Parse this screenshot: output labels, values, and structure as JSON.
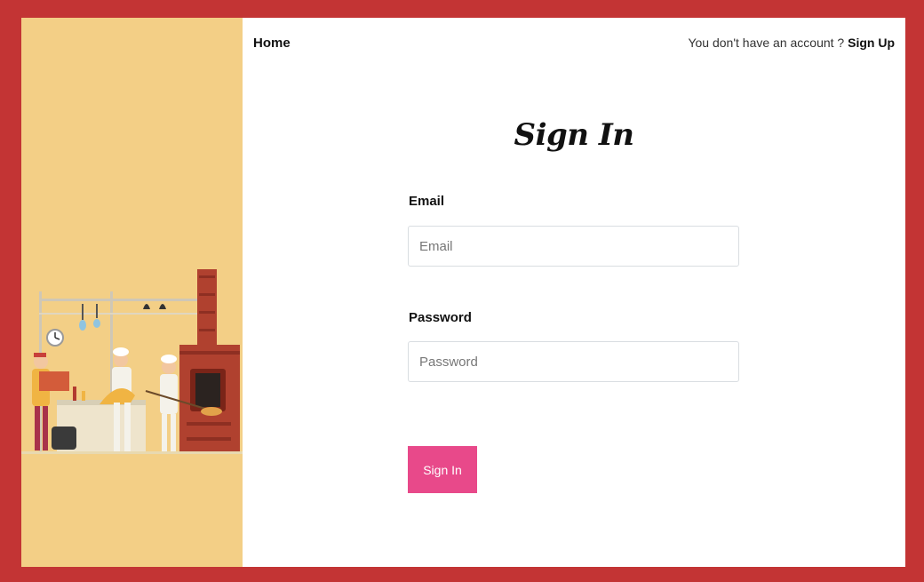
{
  "nav": {
    "home_label": "Home",
    "account_prompt": "You don't have an account ?",
    "signup_label": "Sign Up"
  },
  "form": {
    "title": "Sign In",
    "email_label": "Email",
    "email_placeholder": "Email",
    "email_value": "",
    "password_label": "Password",
    "password_placeholder": "Password",
    "password_value": "",
    "submit_label": "Sign In"
  },
  "colors": {
    "page_border": "#c33434",
    "sidebar_bg": "#f3cf86",
    "button_bg": "#e8498a",
    "button_text": "#ffffff"
  },
  "illustration": {
    "name": "kitchen-chefs-illustration"
  }
}
